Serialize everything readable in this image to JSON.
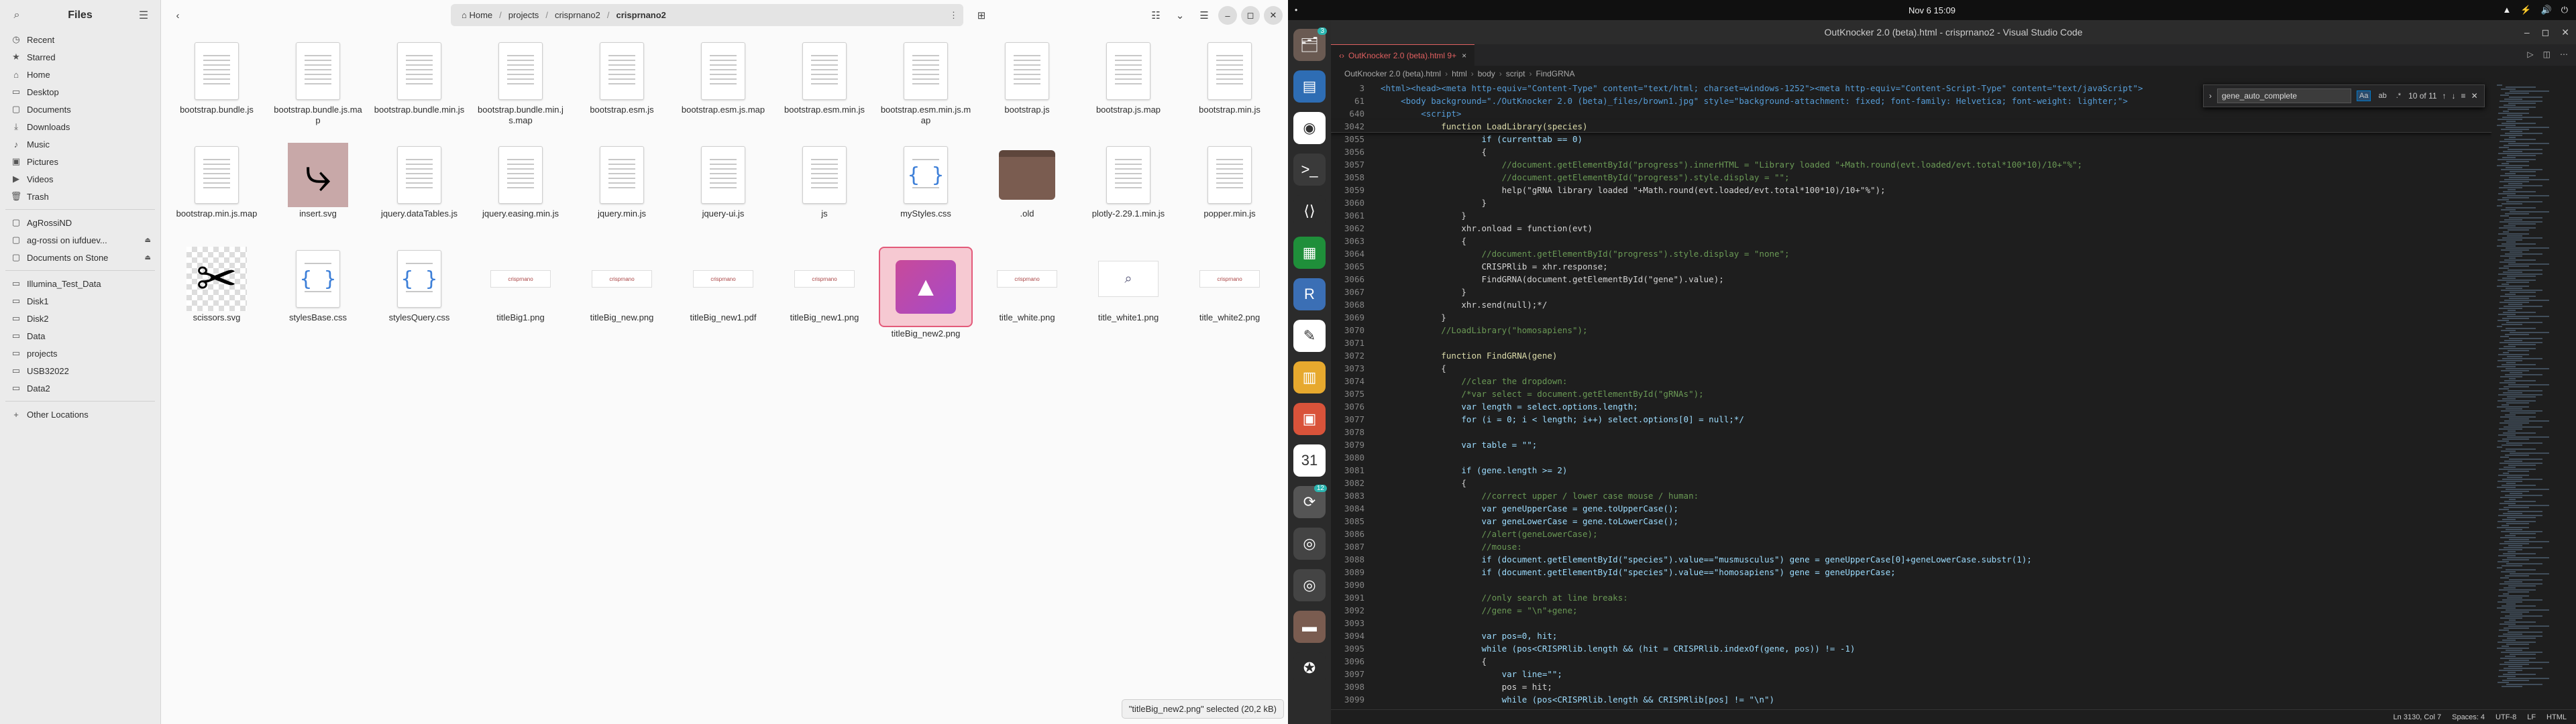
{
  "files": {
    "sidebar_title": "Files",
    "places": [
      {
        "label": "Recent",
        "icon": "clock-icon"
      },
      {
        "label": "Starred",
        "icon": "star-icon"
      },
      {
        "label": "Home",
        "icon": "home-icon"
      },
      {
        "label": "Desktop",
        "icon": "desktop-icon"
      },
      {
        "label": "Documents",
        "icon": "folder-icon"
      },
      {
        "label": "Downloads",
        "icon": "download-icon"
      },
      {
        "label": "Music",
        "icon": "music-icon"
      },
      {
        "label": "Pictures",
        "icon": "pictures-icon"
      },
      {
        "label": "Videos",
        "icon": "video-icon"
      },
      {
        "label": "Trash",
        "icon": "trash-icon"
      }
    ],
    "network": [
      {
        "label": "AgRossiND",
        "icon": "folder-icon",
        "eject": false
      },
      {
        "label": "ag-rossi on iufduev...",
        "icon": "folder-icon",
        "eject": true
      },
      {
        "label": "Documents on Stone",
        "icon": "folder-icon",
        "eject": true
      }
    ],
    "drives": [
      {
        "label": "Illumina_Test_Data",
        "icon": "drive-icon"
      },
      {
        "label": "Disk1",
        "icon": "drive-icon"
      },
      {
        "label": "Disk2",
        "icon": "drive-icon"
      },
      {
        "label": "Data",
        "icon": "drive-icon"
      },
      {
        "label": "projects",
        "icon": "drive-icon"
      },
      {
        "label": "USB32022",
        "icon": "drive-icon"
      },
      {
        "label": "Data2",
        "icon": "drive-icon"
      }
    ],
    "other_locations": "Other Locations",
    "path": {
      "home": "Home",
      "p1": "projects",
      "p2": "crisprnano2",
      "current": "crisprnano2"
    },
    "items": [
      {
        "name": "bootstrap.bundle.js",
        "kind": "doc"
      },
      {
        "name": "bootstrap.bundle.js.map",
        "kind": "doc"
      },
      {
        "name": "bootstrap.bundle.min.js",
        "kind": "doc"
      },
      {
        "name": "bootstrap.bundle.min.js.map",
        "kind": "doc"
      },
      {
        "name": "bootstrap.esm.js",
        "kind": "doc"
      },
      {
        "name": "bootstrap.esm.js.map",
        "kind": "doc"
      },
      {
        "name": "bootstrap.esm.min.js",
        "kind": "doc"
      },
      {
        "name": "bootstrap.esm.min.js.map",
        "kind": "doc"
      },
      {
        "name": "bootstrap.js",
        "kind": "doc"
      },
      {
        "name": "bootstrap.js.map",
        "kind": "doc"
      },
      {
        "name": "bootstrap.min.js",
        "kind": "doc"
      },
      {
        "name": "bootstrap.min.js.map",
        "kind": "doc"
      },
      {
        "name": "insert.svg",
        "kind": "arrow"
      },
      {
        "name": "jquery.dataTables.js",
        "kind": "doc"
      },
      {
        "name": "jquery.easing.min.js",
        "kind": "doc"
      },
      {
        "name": "jquery.min.js",
        "kind": "doc"
      },
      {
        "name": "jquery-ui.js",
        "kind": "doc"
      },
      {
        "name": "js",
        "kind": "doc"
      },
      {
        "name": "myStyles.css",
        "kind": "css"
      },
      {
        "name": ".old",
        "kind": "folder"
      },
      {
        "name": "plotly-2.29.1.min.js",
        "kind": "doc"
      },
      {
        "name": "popper.min.js",
        "kind": "doc"
      },
      {
        "name": "scissors.svg",
        "kind": "scissors"
      },
      {
        "name": "stylesBase.css",
        "kind": "css"
      },
      {
        "name": "stylesQuery.css",
        "kind": "css"
      },
      {
        "name": "titleBig1.png",
        "kind": "banner"
      },
      {
        "name": "titleBig_new.png",
        "kind": "banner"
      },
      {
        "name": "titleBig_new1.pdf",
        "kind": "banner"
      },
      {
        "name": "titleBig_new1.png",
        "kind": "banner"
      },
      {
        "name": "titleBig_new2.png",
        "kind": "selected"
      },
      {
        "name": "title_white.png",
        "kind": "banner"
      },
      {
        "name": "title_white1.png",
        "kind": "logo"
      },
      {
        "name": "title_white2.png",
        "kind": "banner"
      }
    ],
    "status": "\"titleBig_new2.png\" selected (20,2 kB)"
  },
  "desktop": {
    "activities": "•",
    "clock": "Nov 6  15:09",
    "tray": [
      "▲",
      "⚡",
      "🔊",
      "⏻"
    ]
  },
  "dock": [
    {
      "icon": "files-icon",
      "bg": "#6a5a52",
      "glyph": "🗂",
      "badge": "3"
    },
    {
      "icon": "files-app-icon",
      "bg": "#2e6db4",
      "glyph": "▤",
      "badge": ""
    },
    {
      "icon": "chrome-icon",
      "bg": "#ffffff",
      "glyph": "◉",
      "badge": ""
    },
    {
      "icon": "terminal-icon",
      "bg": "#3a3a3a",
      "glyph": ">_",
      "badge": ""
    },
    {
      "icon": "vscode-icon",
      "bg": "#2b2b2b",
      "glyph": "⟨⟩",
      "badge": ""
    },
    {
      "icon": "calc-icon",
      "bg": "#1f8f3a",
      "glyph": "▦",
      "badge": ""
    },
    {
      "icon": "r-icon",
      "bg": "#3b6fb5",
      "glyph": "R",
      "badge": ""
    },
    {
      "icon": "editor-icon",
      "bg": "#ffffff",
      "glyph": "✎",
      "badge": ""
    },
    {
      "icon": "notes-icon",
      "bg": "#e7a92e",
      "glyph": "▥",
      "badge": ""
    },
    {
      "icon": "impress-icon",
      "bg": "#d9533a",
      "glyph": "▣",
      "badge": ""
    },
    {
      "icon": "calendar-icon",
      "bg": "#ffffff",
      "glyph": "31",
      "badge": ""
    },
    {
      "icon": "updater-icon",
      "bg": "#555555",
      "glyph": "⟳",
      "badge": "12"
    },
    {
      "icon": "disk-icon",
      "bg": "#444444",
      "glyph": "◎",
      "badge": ""
    },
    {
      "icon": "disk2-icon",
      "bg": "#444444",
      "glyph": "◎",
      "badge": ""
    },
    {
      "icon": "folder-icon",
      "bg": "#7a5c50",
      "glyph": "▬",
      "badge": ""
    },
    {
      "icon": "ubuntu-icon",
      "bg": "#2b2b2b",
      "glyph": "✪",
      "badge": ""
    }
  ],
  "vscode": {
    "title": "OutKnocker 2.0 (beta).html - crisprnano2 - Visual Studio Code",
    "tab": "OutKnocker 2.0 (beta).html 9+",
    "breadcrumbs": [
      "OutKnocker 2.0 (beta).html",
      "html",
      "body",
      "script",
      "FindGRNA"
    ],
    "find": {
      "query": "gene_auto_complete",
      "count": "10 of 11",
      "opt1": "Aa",
      "opt2": "ab",
      "opt3": ".*"
    },
    "lines": [
      {
        "no": "3",
        "text": "<html><head><meta http-equiv=\"Content-Type\" content=\"text/html; charset=windows-1252\"><meta http-equiv=\"Content-Script-Type\" content=\"text/javaScript\">",
        "sticky": true
      },
      {
        "no": "61",
        "text": "    <body background=\"./OutKnocker 2.0 (beta)_files/brown1.jpg\" style=\"background-attachment: fixed; font-family: Helvetica; font-weight: lighter;\">",
        "sticky": true
      },
      {
        "no": "640",
        "text": "        <script>",
        "sticky": true
      },
      {
        "no": "3042",
        "text": "            function LoadLibrary(species)",
        "sticky": true,
        "end": true
      },
      {
        "no": "3055",
        "text": "                    if (currenttab == 0)"
      },
      {
        "no": "3056",
        "text": "                    {"
      },
      {
        "no": "3057",
        "text": "                        //document.getElementById(\"progress\").innerHTML = \"Library loaded \"+Math.round(evt.loaded/evt.total*100*10)/10+\"%\";"
      },
      {
        "no": "3058",
        "text": "                        //document.getElementById(\"progress\").style.display = \"\";"
      },
      {
        "no": "3059",
        "text": "                        help(\"gRNA library loaded \"+Math.round(evt.loaded/evt.total*100*10)/10+\"%\");"
      },
      {
        "no": "3060",
        "text": "                    }"
      },
      {
        "no": "3061",
        "text": "                }"
      },
      {
        "no": "3062",
        "text": "                xhr.onload = function(evt)"
      },
      {
        "no": "3063",
        "text": "                {"
      },
      {
        "no": "3064",
        "text": "                    //document.getElementById(\"progress\").style.display = \"none\";"
      },
      {
        "no": "3065",
        "text": "                    CRISPRlib = xhr.response;"
      },
      {
        "no": "3066",
        "text": "                    FindGRNA(document.getElementById(\"gene\").value);"
      },
      {
        "no": "3067",
        "text": "                }"
      },
      {
        "no": "3068",
        "text": "                xhr.send(null);*/"
      },
      {
        "no": "3069",
        "text": "            }"
      },
      {
        "no": "3070",
        "text": "            //LoadLibrary(\"homosapiens\");"
      },
      {
        "no": "3071",
        "text": ""
      },
      {
        "no": "3072",
        "text": "            function FindGRNA(gene)"
      },
      {
        "no": "3073",
        "text": "            {"
      },
      {
        "no": "3074",
        "text": "                //clear the dropdown:"
      },
      {
        "no": "3075",
        "text": "                /*var select = document.getElementById(\"gRNAs\");"
      },
      {
        "no": "3076",
        "text": "                var length = select.options.length;"
      },
      {
        "no": "3077",
        "text": "                for (i = 0; i < length; i++) select.options[0] = null;*/"
      },
      {
        "no": "3078",
        "text": ""
      },
      {
        "no": "3079",
        "text": "                var table = \"\";"
      },
      {
        "no": "3080",
        "text": ""
      },
      {
        "no": "3081",
        "text": "                if (gene.length >= 2)"
      },
      {
        "no": "3082",
        "text": "                {"
      },
      {
        "no": "3083",
        "text": "                    //correct upper / lower case mouse / human:"
      },
      {
        "no": "3084",
        "text": "                    var geneUpperCase = gene.toUpperCase();"
      },
      {
        "no": "3085",
        "text": "                    var geneLowerCase = gene.toLowerCase();"
      },
      {
        "no": "3086",
        "text": "                    //alert(geneLowerCase);"
      },
      {
        "no": "3087",
        "text": "                    //mouse:"
      },
      {
        "no": "3088",
        "text": "                    if (document.getElementById(\"species\").value==\"musmusculus\") gene = geneUpperCase[0]+geneLowerCase.substr(1);"
      },
      {
        "no": "3089",
        "text": "                    if (document.getElementById(\"species\").value==\"homosapiens\") gene = geneUpperCase;"
      },
      {
        "no": "3090",
        "text": ""
      },
      {
        "no": "3091",
        "text": "                    //only search at line breaks:"
      },
      {
        "no": "3092",
        "text": "                    //gene = \"\\n\"+gene;"
      },
      {
        "no": "3093",
        "text": ""
      },
      {
        "no": "3094",
        "text": "                    var pos=0, hit;"
      },
      {
        "no": "3095",
        "text": "                    while (pos<CRISPRlib.length && (hit = CRISPRlib.indexOf(gene, pos)) != -1)"
      },
      {
        "no": "3096",
        "text": "                    {"
      },
      {
        "no": "3097",
        "text": "                        var line=\"\";"
      },
      {
        "no": "3098",
        "text": "                        pos = hit;"
      },
      {
        "no": "3099",
        "text": "                        while (pos<CRISPRlib.length && CRISPRlib[pos] != \"\\n\")"
      }
    ],
    "status": [
      "Ln 3130, Col 7",
      "Spaces: 4",
      "UTF-8",
      "LF",
      "HTML"
    ]
  }
}
